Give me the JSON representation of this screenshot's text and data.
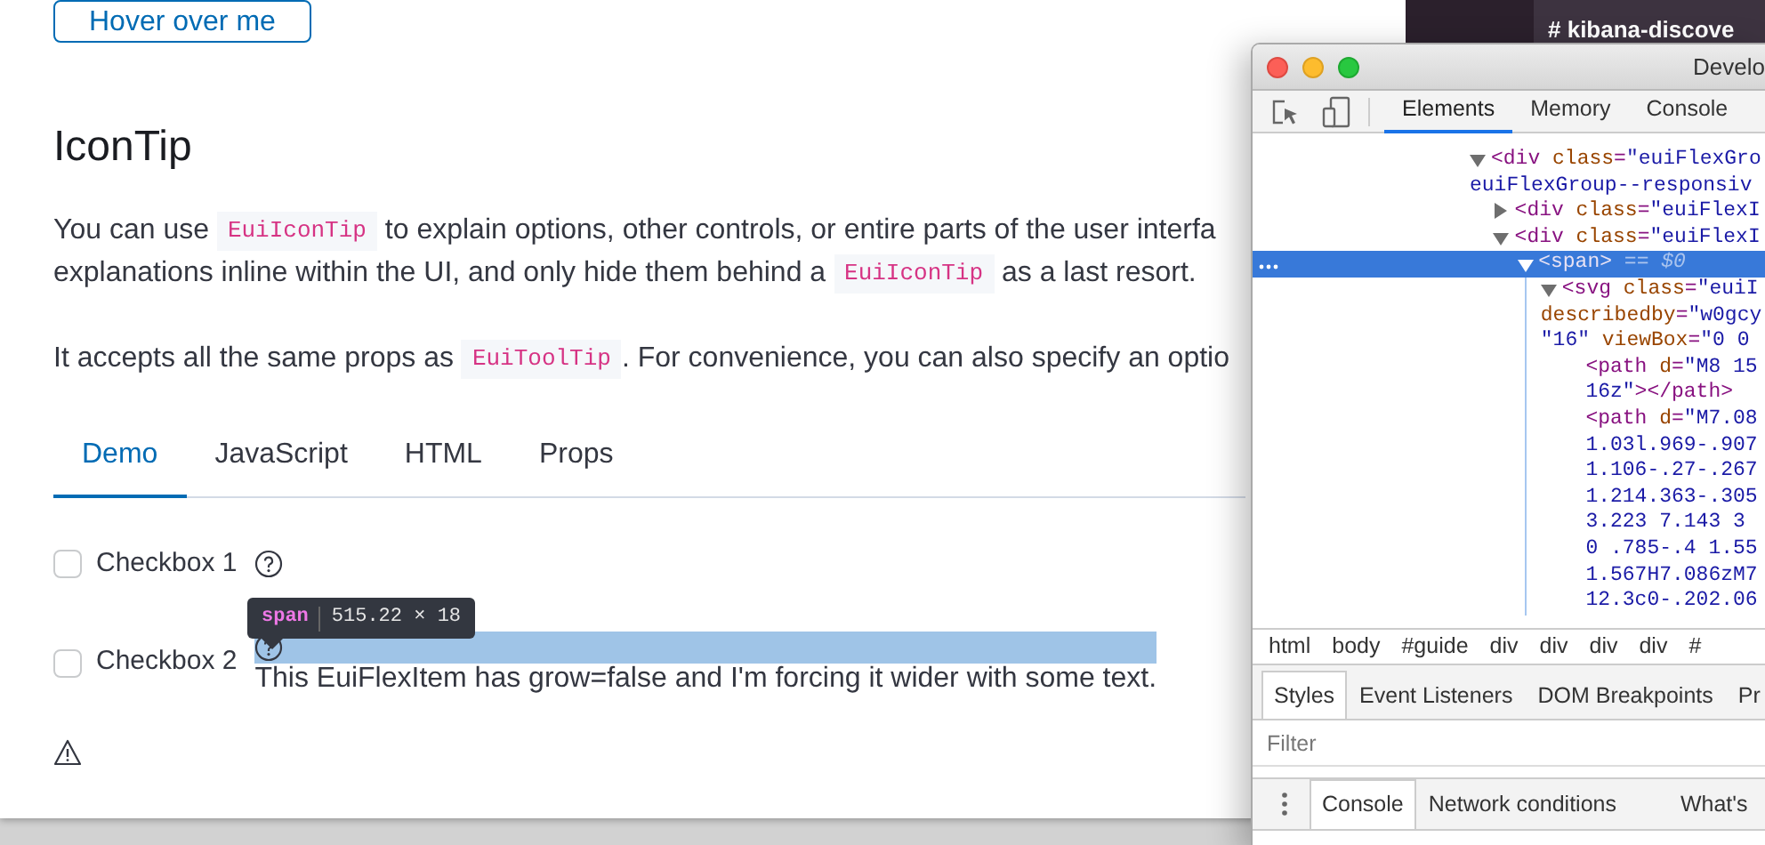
{
  "page": {
    "button": "Hover over me",
    "heading": "IconTip",
    "paragraphs": [
      {
        "lines": [
          [
            {
              "text": "You can use ",
              "code": false
            },
            {
              "text": "EuiIconTip",
              "code": true
            },
            {
              "text": " to explain options, other controls, or entire parts of the user interfa",
              "code": false
            }
          ],
          [
            {
              "text": "explanations inline within the UI, and only hide them behind a ",
              "code": false
            },
            {
              "text": "EuiIconTip",
              "code": true
            },
            {
              "text": " as a last resort.",
              "code": false
            }
          ]
        ]
      },
      {
        "lines": [
          [
            {
              "text": "It accepts all the same props as ",
              "code": false
            },
            {
              "text": "EuiToolTip",
              "code": true
            },
            {
              "text": ". For convenience, you can also specify an optio",
              "code": false
            }
          ]
        ]
      }
    ],
    "tabs": [
      {
        "label": "Demo",
        "selected": true
      },
      {
        "label": "JavaScript",
        "selected": false
      },
      {
        "label": "HTML",
        "selected": false
      },
      {
        "label": "Props",
        "selected": false
      }
    ],
    "demo": {
      "rows": [
        {
          "label": "Checkbox 1",
          "checked": false,
          "highlighted": false
        },
        {
          "label": "Checkbox 2",
          "checked": false,
          "highlighted": true,
          "note": "This EuiFlexItem has grow=false and I'm forcing it wider with some text."
        }
      ],
      "inspector_tooltip": {
        "tag": "span",
        "size": "515.22 × 18"
      }
    }
  },
  "chat_sidebar": {
    "channels": [
      {
        "name": "# kibana-discove",
        "unread": true
      }
    ]
  },
  "devtools": {
    "title": "Develo",
    "tabs": [
      {
        "label": "Elements",
        "selected": true
      },
      {
        "label": "Memory",
        "selected": false
      },
      {
        "label": "Console",
        "selected": false
      }
    ],
    "tree": [
      {
        "expanded": true,
        "selected": false,
        "lines": [
          [
            {
              "kind": "tag",
              "text": "<div"
            },
            {
              "kind": "attr",
              "text": " class"
            },
            {
              "kind": "tag",
              "text": "="
            },
            {
              "kind": "value",
              "text": "\"euiFlexGro"
            }
          ],
          [
            {
              "kind": "value",
              "text": "euiFlexGroup--responsiv"
            }
          ]
        ],
        "children": [
          {
            "expanded": false,
            "selected": false,
            "lines": [
              [
                {
                  "kind": "tag",
                  "text": "<div"
                },
                {
                  "kind": "attr",
                  "text": " class"
                },
                {
                  "kind": "tag",
                  "text": "="
                },
                {
                  "kind": "value",
                  "text": "\"euiFlexI"
                }
              ]
            ]
          },
          {
            "expanded": true,
            "selected": false,
            "lines": [
              [
                {
                  "kind": "tag",
                  "text": "<div"
                },
                {
                  "kind": "attr",
                  "text": " class"
                },
                {
                  "kind": "tag",
                  "text": "="
                },
                {
                  "kind": "value",
                  "text": "\"euiFlexI"
                }
              ]
            ],
            "children": [
              {
                "expanded": true,
                "selected": true,
                "lines": [
                  [
                    {
                      "kind": "tag",
                      "text": "<span>"
                    },
                    {
                      "kind": "ref",
                      "text": " == $0"
                    }
                  ]
                ],
                "children": [
                  {
                    "expanded": true,
                    "selected": false,
                    "lines": [
                      [
                        {
                          "kind": "tag",
                          "text": "<svg"
                        },
                        {
                          "kind": "attr",
                          "text": " class"
                        },
                        {
                          "kind": "tag",
                          "text": "="
                        },
                        {
                          "kind": "value",
                          "text": "\"euiI"
                        }
                      ],
                      [
                        {
                          "kind": "attr",
                          "text": "describedby"
                        },
                        {
                          "kind": "tag",
                          "text": "="
                        },
                        {
                          "kind": "value",
                          "text": "\"w0gcy"
                        }
                      ],
                      [
                        {
                          "kind": "value",
                          "text": "\"16\""
                        },
                        {
                          "kind": "attr",
                          "text": " viewBox"
                        },
                        {
                          "kind": "tag",
                          "text": "="
                        },
                        {
                          "kind": "value",
                          "text": "\"0 0"
                        }
                      ]
                    ],
                    "children": [
                      {
                        "selected": false,
                        "lines": [
                          [
                            {
                              "kind": "tag",
                              "text": "<path"
                            },
                            {
                              "kind": "attr",
                              "text": " d"
                            },
                            {
                              "kind": "tag",
                              "text": "="
                            },
                            {
                              "kind": "value",
                              "text": "\"M8 15"
                            }
                          ],
                          [
                            {
                              "kind": "value",
                              "text": "16z\""
                            },
                            {
                              "kind": "tag",
                              "text": "></path>"
                            }
                          ]
                        ]
                      },
                      {
                        "selected": false,
                        "lines": [
                          [
                            {
                              "kind": "tag",
                              "text": "<path"
                            },
                            {
                              "kind": "attr",
                              "text": " d"
                            },
                            {
                              "kind": "tag",
                              "text": "="
                            },
                            {
                              "kind": "value",
                              "text": "\"M7.08"
                            }
                          ],
                          [
                            {
                              "kind": "value",
                              "text": "1.03l.969-.907"
                            }
                          ],
                          [
                            {
                              "kind": "value",
                              "text": "1.106-.27-.267"
                            }
                          ],
                          [
                            {
                              "kind": "value",
                              "text": "1.214.363-.305"
                            }
                          ],
                          [
                            {
                              "kind": "value",
                              "text": "3.223 7.143 3"
                            }
                          ],
                          [
                            {
                              "kind": "value",
                              "text": "0 .785-.4 1.55"
                            }
                          ],
                          [
                            {
                              "kind": "value",
                              "text": "1.567H7.086zM7"
                            }
                          ],
                          [
                            {
                              "kind": "value",
                              "text": "12.3c0-.202.06"
                            }
                          ]
                        ]
                      }
                    ]
                  }
                ]
              }
            ]
          }
        ]
      }
    ],
    "breadcrumbs": [
      "html",
      "body",
      "#guide",
      "div",
      "div",
      "div",
      "div",
      "#"
    ],
    "side_tabs": [
      {
        "label": "Styles",
        "selected": true
      },
      {
        "label": "Event Listeners",
        "selected": false
      },
      {
        "label": "DOM Breakpoints",
        "selected": false
      },
      {
        "label": "Pr",
        "selected": false
      }
    ],
    "filter": {
      "placeholder": "Filter"
    },
    "drawer_tabs": [
      {
        "label": "Console",
        "selected": true
      },
      {
        "label": "Network conditions",
        "selected": false
      },
      {
        "label": "What's",
        "selected": false
      }
    ]
  }
}
